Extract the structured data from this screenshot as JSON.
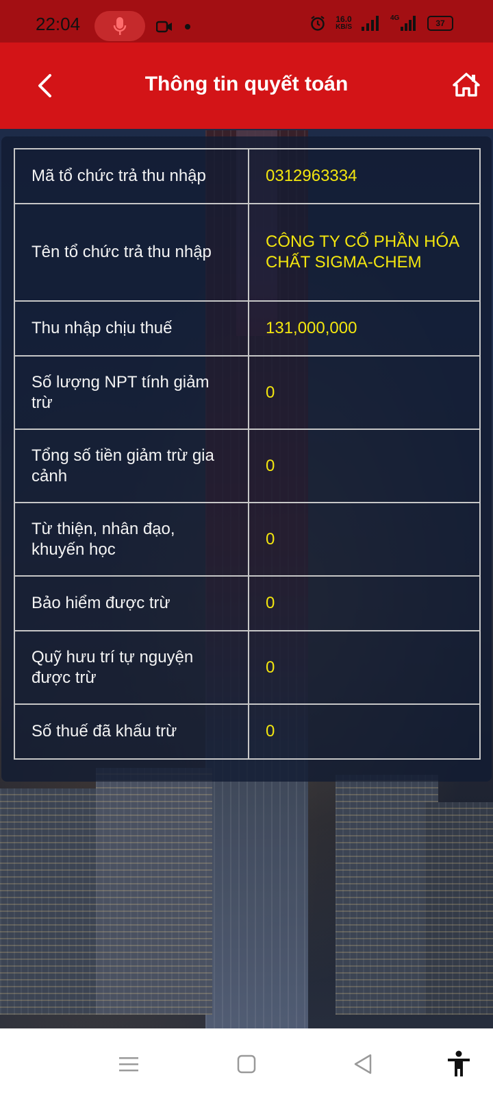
{
  "status_bar": {
    "time": "22:04",
    "net_speed_value": "16.0",
    "net_speed_unit": "KB/S",
    "network_type": "4G",
    "battery": "37",
    "icons": [
      "mic-icon",
      "video-camera-icon",
      "dot-icon",
      "alarm-icon",
      "signal-icon",
      "signal-4g-icon",
      "battery-icon"
    ]
  },
  "header": {
    "title": "Thông tin quyết toán",
    "icons": [
      "back-arrow-icon",
      "home-icon"
    ]
  },
  "rows": [
    {
      "label": "Mã tổ chức trả thu nhập",
      "value": "0312963334"
    },
    {
      "label": "Tên tổ chức trả thu nhập",
      "value": "CÔNG TY CỔ PHẦN HÓA CHẤT SIGMA-CHEM"
    },
    {
      "label": "Thu nhập chịu thuế",
      "value": "131,000,000"
    },
    {
      "label": "Số lượng NPT tính giảm trừ",
      "value": "0"
    },
    {
      "label": "Tổng số tiền giảm trừ gia cảnh",
      "value": "0"
    },
    {
      "label": "Từ thiện, nhân đạo, khuyến học",
      "value": "0"
    },
    {
      "label": "Bảo hiểm được trừ",
      "value": "0"
    },
    {
      "label": "Quỹ hưu trí tự nguyện được trừ",
      "value": "0"
    },
    {
      "label": "Số thuế đã khấu trừ",
      "value": "0"
    }
  ],
  "colors": {
    "status_bar": "#a30f13",
    "header": "#d31417",
    "value_text": "#f3e60f"
  },
  "nav_bar": {
    "icons": [
      "menu-icon",
      "square-home-icon",
      "back-triangle-icon",
      "accessibility-icon"
    ]
  }
}
